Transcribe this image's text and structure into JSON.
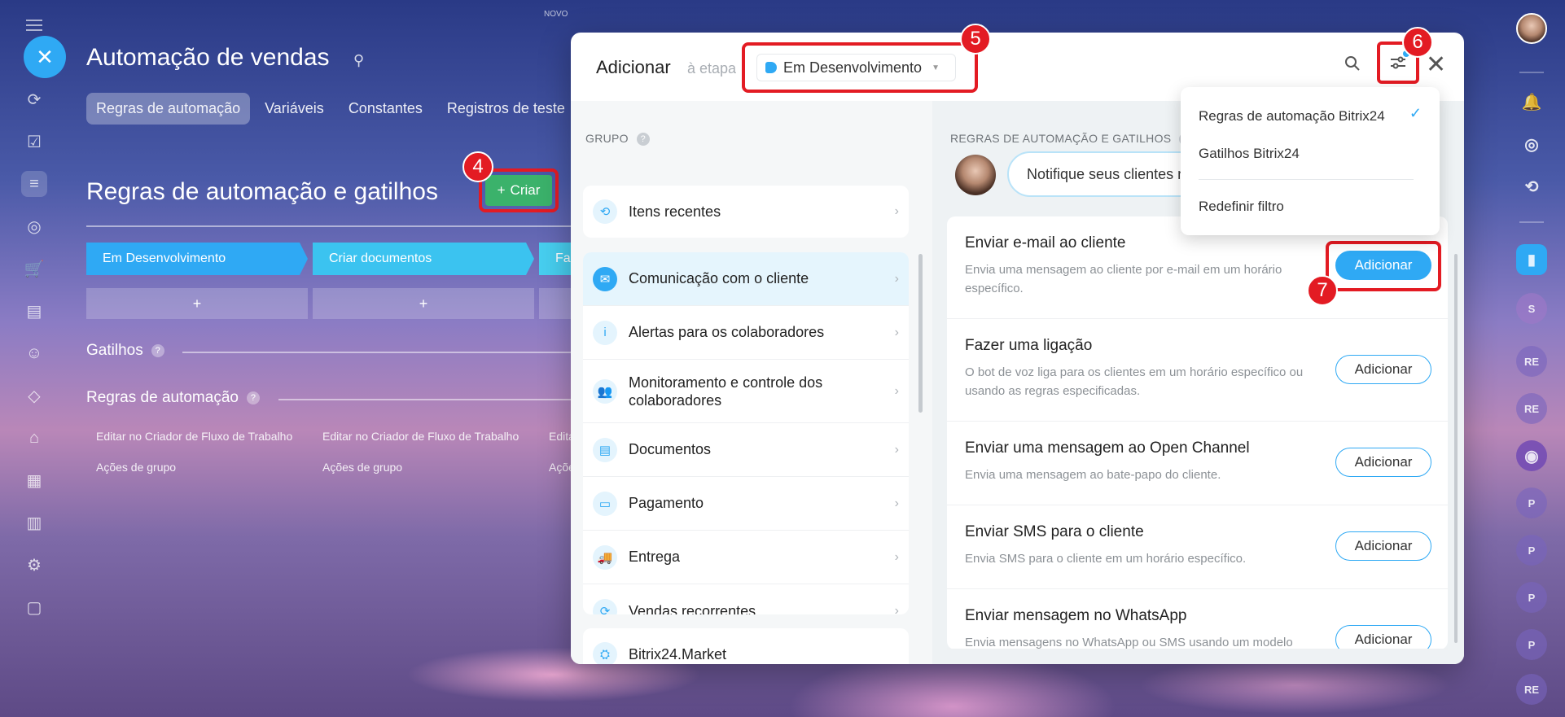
{
  "top_label": "NOVO",
  "page": {
    "title": "Automação de vendas",
    "tabs": [
      "Regras de automação",
      "Variáveis",
      "Constantes",
      "Registros de teste"
    ],
    "section_title": "Regras de automação e gatilhos",
    "create_button": "Criar",
    "stages": [
      "Em Desenvolvimento",
      "Criar documentos",
      "Fa"
    ],
    "plus": "+",
    "triggers_label": "Gatilhos",
    "rules_label": "Regras de automação",
    "help": "?",
    "row1": [
      "Editar no Criador de Fluxo de Trabalho",
      "Editar no Criador de Fluxo de Trabalho",
      "Edita"
    ],
    "row2": [
      "Ações de grupo",
      "Ações de grupo",
      "Açõe"
    ]
  },
  "dialog": {
    "title": "Adicionar",
    "subtitle": "à etapa",
    "stage_value": "Em Desenvolvimento",
    "group_label": "GRUPO",
    "rules_label": "REGRAS DE AUTOMAÇÃO E GATILHOS",
    "recent": "Itens recentes",
    "groups": [
      "Comunicação com o cliente",
      "Alertas para os colaboradores",
      "Monitoramento e controle dos colaboradores",
      "Documentos",
      "Pagamento",
      "Entrega",
      "Vendas recorrentes"
    ],
    "market": "Bitrix24.Market",
    "bubble": "Notifique seus clientes n",
    "add_label": "Adicionar",
    "rules": [
      {
        "title": "Enviar e-mail ao cliente",
        "desc": "Envia uma mensagem ao cliente por e-mail em um horário específico."
      },
      {
        "title": "Fazer uma ligação",
        "desc": "O bot de voz liga para os clientes em um horário específico ou usando as regras especificadas."
      },
      {
        "title": "Enviar uma mensagem ao Open Channel",
        "desc": "Envia uma mensagem ao bate-papo do cliente."
      },
      {
        "title": "Enviar SMS para o cliente",
        "desc": "Envia SMS para o cliente em um horário específico."
      },
      {
        "title": "Enviar mensagem no WhatsApp",
        "desc": "Envia mensagens no WhatsApp ou SMS usando um modelo"
      }
    ]
  },
  "filter_menu": {
    "items": [
      "Regras de automação Bitrix24",
      "Gatilhos Bitrix24",
      "Redefinir filtro"
    ],
    "checked": "Regras de automação Bitrix24"
  },
  "badges": [
    "4",
    "5",
    "6",
    "7"
  ],
  "right_rail": [
    "S",
    "RE",
    "RE",
    "P",
    "P",
    "P",
    "P",
    "RE"
  ],
  "colors": {
    "accent": "#2fa9f4",
    "create": "#3bb26b",
    "highlight": "#e31b23"
  }
}
